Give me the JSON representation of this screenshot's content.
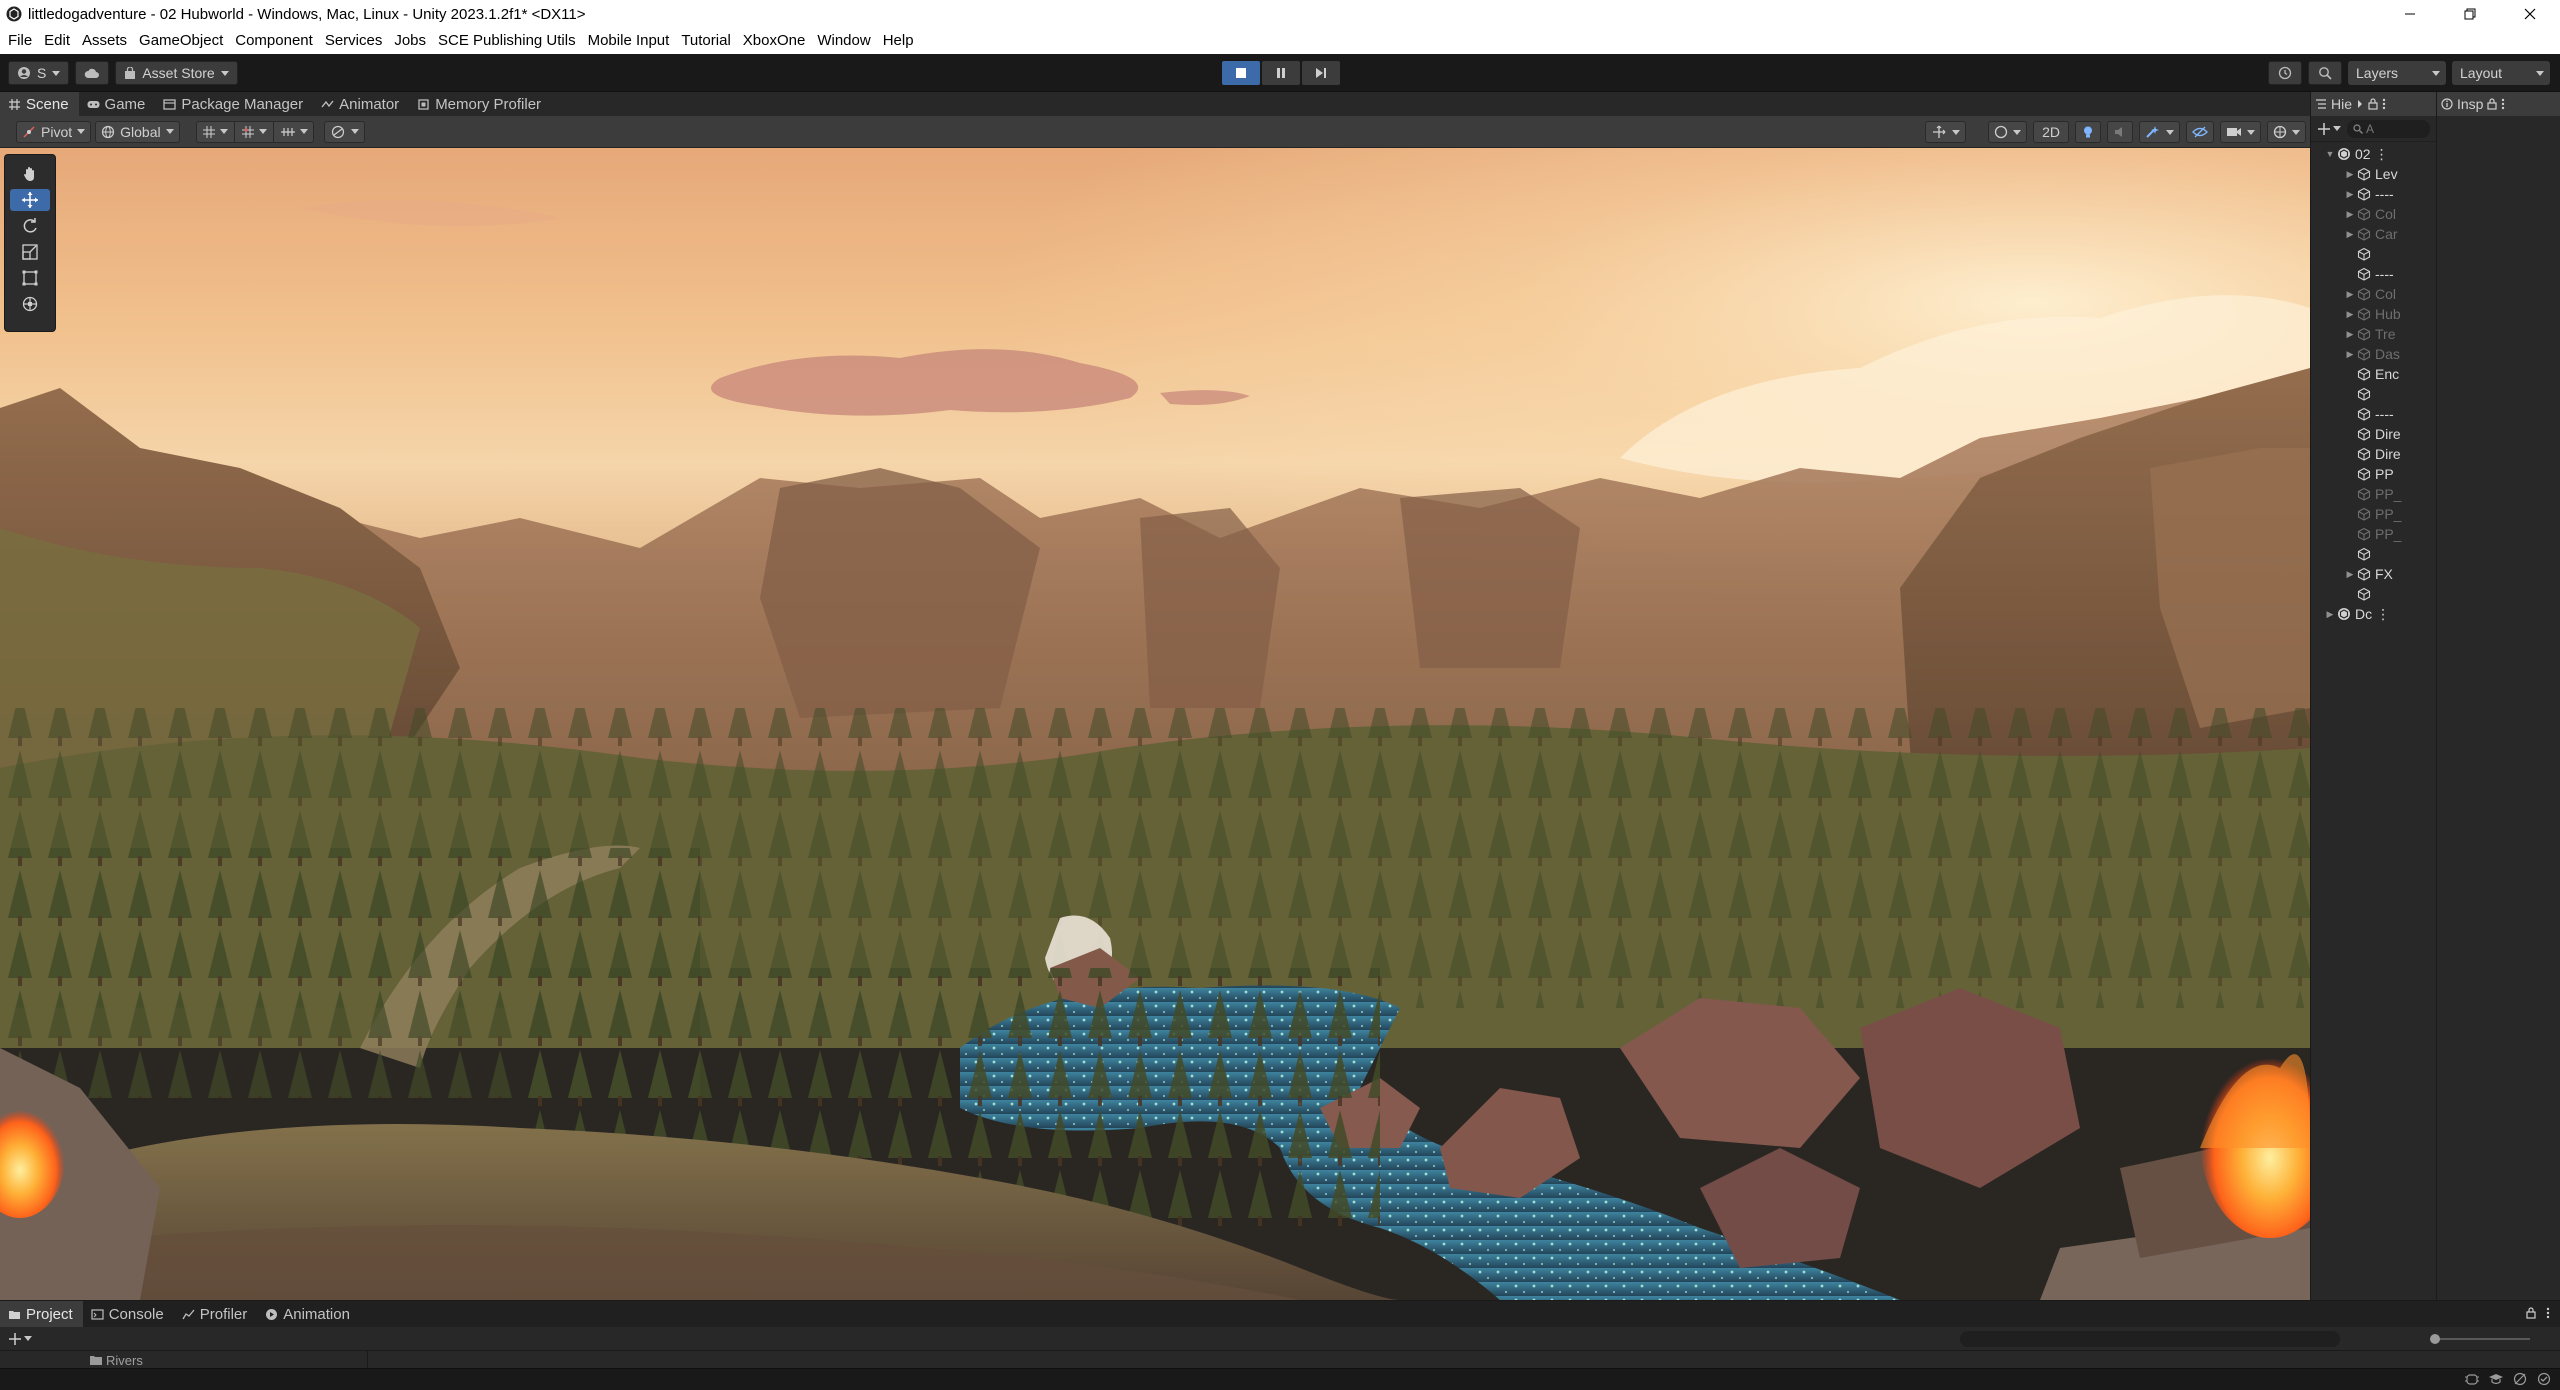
{
  "window": {
    "title": "littledogadventure - 02 Hubworld - Windows, Mac, Linux - Unity 2023.1.2f1* <DX11>"
  },
  "menu": [
    "File",
    "Edit",
    "Assets",
    "GameObject",
    "Component",
    "Services",
    "Jobs",
    "SCE Publishing Utils",
    "Mobile Input",
    "Tutorial",
    "XboxOne",
    "Window",
    "Help"
  ],
  "toolbar": {
    "account_label": "S",
    "asset_store_label": "Asset Store",
    "layers_label": "Layers",
    "layout_label": "Layout",
    "play_state": "playing"
  },
  "scene_tabs": [
    {
      "label": "Scene",
      "icon": "grid-icon",
      "active": true
    },
    {
      "label": "Game",
      "icon": "gamepad-icon",
      "active": false
    },
    {
      "label": "Package Manager",
      "icon": "package-icon",
      "active": false
    },
    {
      "label": "Animator",
      "icon": "animator-icon",
      "active": false
    },
    {
      "label": "Memory Profiler",
      "icon": "memory-icon",
      "active": false
    }
  ],
  "scene_toolbar": {
    "pivot_label": "Pivot",
    "global_label": "Global",
    "mode_2d_label": "2D"
  },
  "tools": [
    "hand-tool-icon",
    "move-tool-icon",
    "rotate-tool-icon",
    "scale-tool-icon",
    "rect-tool-icon",
    "transform-tool-icon"
  ],
  "active_tool": "move-tool-icon",
  "hierarchy": {
    "tab_label": "Hie",
    "search_placeholder": "A",
    "rows": [
      {
        "label": "02",
        "indent": 0,
        "fold": "▼",
        "icon": "unity-scene-icon",
        "dim": false
      },
      {
        "label": "Lev",
        "indent": 1,
        "fold": "▶",
        "icon": "cube-icon",
        "dim": false
      },
      {
        "label": "----",
        "indent": 1,
        "fold": "▶",
        "icon": "cube-icon",
        "dim": false
      },
      {
        "label": "Col",
        "indent": 1,
        "fold": "▶",
        "icon": "cube-icon",
        "dim": true
      },
      {
        "label": "Car",
        "indent": 1,
        "fold": "▶",
        "icon": "cube-icon",
        "dim": true
      },
      {
        "label": "",
        "indent": 1,
        "fold": "",
        "icon": "cube-icon",
        "dim": false
      },
      {
        "label": "----",
        "indent": 1,
        "fold": "",
        "icon": "cube-icon",
        "dim": false
      },
      {
        "label": "Col",
        "indent": 1,
        "fold": "▶",
        "icon": "cube-icon",
        "dim": true
      },
      {
        "label": "Hub",
        "indent": 1,
        "fold": "▶",
        "icon": "cube-icon",
        "dim": true
      },
      {
        "label": "Tre",
        "indent": 1,
        "fold": "▶",
        "icon": "cube-icon",
        "dim": true
      },
      {
        "label": "Das",
        "indent": 1,
        "fold": "▶",
        "icon": "cube-icon",
        "dim": true
      },
      {
        "label": "Enc",
        "indent": 1,
        "fold": "",
        "icon": "cube-icon",
        "dim": false
      },
      {
        "label": "",
        "indent": 1,
        "fold": "",
        "icon": "cube-icon",
        "dim": false
      },
      {
        "label": "----",
        "indent": 1,
        "fold": "",
        "icon": "cube-icon",
        "dim": false
      },
      {
        "label": "Dire",
        "indent": 1,
        "fold": "",
        "icon": "cube-icon",
        "dim": false
      },
      {
        "label": "Dire",
        "indent": 1,
        "fold": "",
        "icon": "cube-icon",
        "dim": false
      },
      {
        "label": "PP",
        "indent": 1,
        "fold": "",
        "icon": "cube-icon",
        "dim": false
      },
      {
        "label": "PP_",
        "indent": 1,
        "fold": "",
        "icon": "cube-icon",
        "dim": true
      },
      {
        "label": "PP_",
        "indent": 1,
        "fold": "",
        "icon": "cube-icon",
        "dim": true
      },
      {
        "label": "PP_",
        "indent": 1,
        "fold": "",
        "icon": "cube-icon",
        "dim": true
      },
      {
        "label": "",
        "indent": 1,
        "fold": "",
        "icon": "cube-icon",
        "dim": false
      },
      {
        "label": "FX",
        "indent": 1,
        "fold": "▶",
        "icon": "cube-icon",
        "dim": false
      },
      {
        "label": "",
        "indent": 1,
        "fold": "",
        "icon": "cube-icon",
        "dim": false
      },
      {
        "label": "Dc",
        "indent": 0,
        "fold": "▶",
        "icon": "unity-scene-icon",
        "dim": false
      }
    ]
  },
  "inspector": {
    "tab_label": "Insp"
  },
  "bottom_tabs": [
    {
      "label": "Project",
      "icon": "folder-icon",
      "active": true
    },
    {
      "label": "Console",
      "icon": "console-icon",
      "active": false
    },
    {
      "label": "Profiler",
      "icon": "profiler-icon",
      "active": false
    },
    {
      "label": "Animation",
      "icon": "animation-icon",
      "active": false
    }
  ],
  "bottom": {
    "folder_label": "Rivers"
  },
  "colors": {
    "accent": "#3d6aa8",
    "panel": "#282828",
    "toolbar": "#3c3c3c",
    "sky_top": "#f3c48c",
    "sky_horizon": "#f6d3a6",
    "water": "#1e5270"
  }
}
